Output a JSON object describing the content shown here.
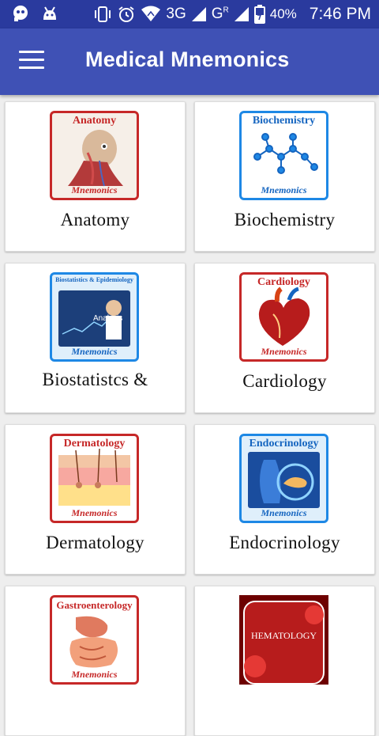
{
  "status_bar": {
    "network_1": "3G",
    "network_2": "G",
    "network_2_sup": "R",
    "battery": "40%",
    "time": "7:46 PM"
  },
  "app_bar": {
    "title": "Medical Mnemonics"
  },
  "cards": [
    {
      "label": "Anatomy",
      "thumb_title": "Anatomy",
      "thumb_footer": "Mnemonics"
    },
    {
      "label": "Biochemistry",
      "thumb_title": "Biochemistry",
      "thumb_footer": "Mnemonics"
    },
    {
      "label": "Biostatistcs &",
      "thumb_title": "Biostatistics & Epidemiology",
      "thumb_inner": "Analysis",
      "thumb_footer": "Mnemonics"
    },
    {
      "label": "Cardiology",
      "thumb_title": "Cardiology",
      "thumb_footer": "Mnemonics"
    },
    {
      "label": "Dermatology",
      "thumb_title": "Dermatology",
      "thumb_footer": "Mnemonics"
    },
    {
      "label": "Endocrinology",
      "thumb_title": "Endocrinology",
      "thumb_footer": "Mnemonics"
    },
    {
      "label": "",
      "thumb_title": "Gastroenterology",
      "thumb_footer": "Mnemonics"
    },
    {
      "label": "",
      "thumb_title": "HEMATOLOGY"
    }
  ],
  "colors": {
    "status_bar": "#2a3a9e",
    "app_bar": "#3f51b5",
    "background": "#eeeeee",
    "red_frame": "#c62828",
    "blue_frame": "#1e88e5"
  }
}
